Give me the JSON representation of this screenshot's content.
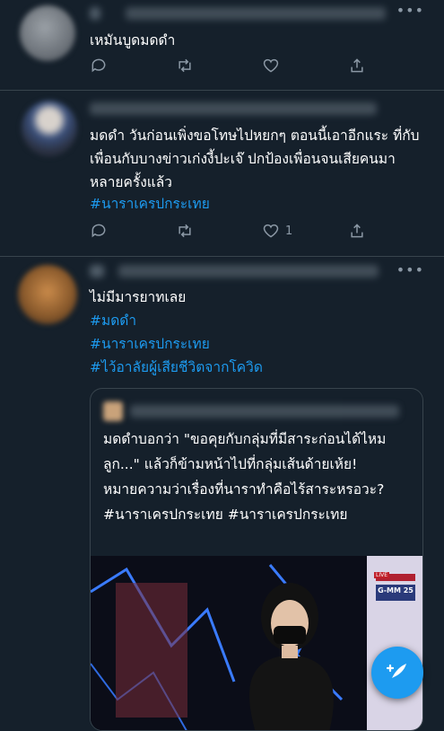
{
  "tweets": [
    {
      "text": "เหมันบูดมดดำ",
      "actions": {
        "like_count": ""
      }
    },
    {
      "text": "มดดำ วันก่อนเพิ่งขอโทษไปหยกๆ ตอนนี้เอาอีกแระ ที่กับเพื่อนกับบางข่าวเก่งงี้ปะเจ๊ ปกป้องเพื่อนจนเสียคนมาหลายครั้งแล้ว",
      "hashtag": "#นาราเครปกระเทย",
      "actions": {
        "like_count": "1"
      }
    },
    {
      "text": "ไม่มีมารยาทเลย",
      "hashtags": [
        "#มดดำ",
        "#นาราเครปกระเทย",
        "#ไว้อาลัยผู้เสียชีวิตจากโควิด"
      ],
      "quote": {
        "text": "มดดำบอกว่า \"ขอคุยกับกลุ่มที่มีสาระก่อนได้ไหมลูก...\" แล้วก็ข้ามหน้าไปที่กลุ่มเส้นด้ายเห้ย! หมายความว่าเรื่องที่นาราทำคือไร้สาระหรอวะ? #นาราเครปกระเทย #นาราเครปกระเทย",
        "media": {
          "badge_live": "LIVE",
          "badge_channel": "G-MM 25"
        }
      }
    }
  ],
  "icons": {
    "reply": "reply-icon",
    "retweet": "retweet-icon",
    "like": "heart-icon",
    "share": "share-icon",
    "more": "more-icon",
    "compose": "compose-tweet-icon"
  },
  "colors": {
    "background": "#15202b",
    "accent": "#1d9bf0",
    "muted": "#8b98a5",
    "border": "#38444d"
  }
}
